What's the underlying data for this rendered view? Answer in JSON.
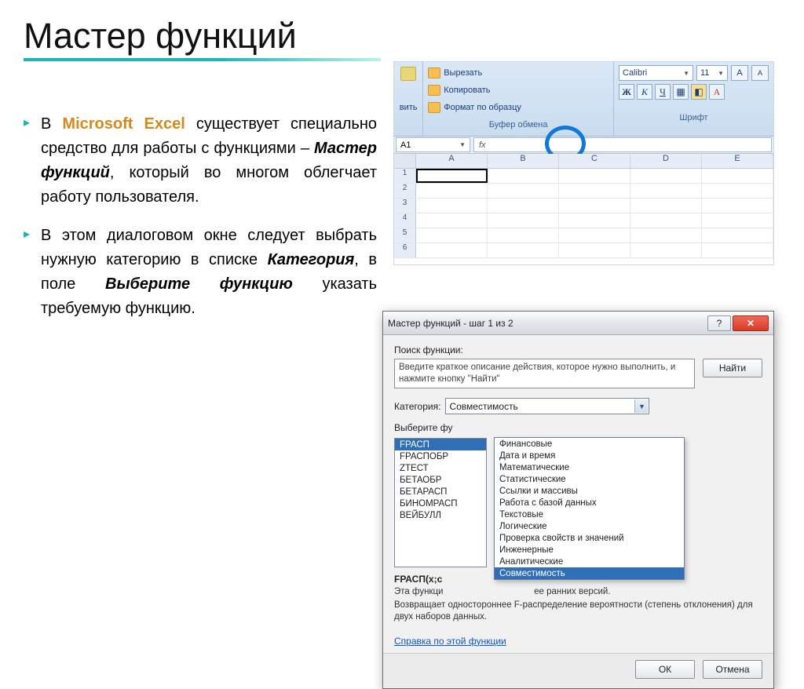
{
  "title": "Мастер функций",
  "paragraphs": {
    "p1_pre": "В ",
    "p1_hl": "Microsoft Excel",
    "p1_mid": " существует специально средство для работы с функциями – ",
    "p1_bi": "Мастер функций",
    "p1_post": ", который во многом облегчает работу пользователя.",
    "p2_pre": "В этом диалоговом окне следует выбрать нужную категорию в списке ",
    "p2_b1": "Категория",
    "p2_mid": ", в поле ",
    "p2_b2": "Выберите функцию",
    "p2_post": " указать требуемую функцию."
  },
  "ribbon": {
    "left_label": "вить",
    "cut": "Вырезать",
    "copy": "Копировать",
    "format_painter": "Формат по образцу",
    "clipboard_group": "Буфер обмена",
    "font_name": "Calibri",
    "font_size": "11",
    "bold": "Ж",
    "italic": "К",
    "underline": "Ч",
    "font_group": "Шрифт"
  },
  "sheet": {
    "namebox": "A1",
    "fx": "fx",
    "cols": [
      "A",
      "B",
      "C",
      "D",
      "E"
    ],
    "rows": [
      "1",
      "2",
      "3",
      "4",
      "5",
      "6"
    ]
  },
  "dialog": {
    "title": "Мастер функций - шаг 1 из 2",
    "search_label": "Поиск функции:",
    "search_text": "Введите краткое описание действия, которое нужно выполнить, и нажмите кнопку \"Найти\"",
    "find_btn": "Найти",
    "category_label": "Категория:",
    "category_value": "Совместимость",
    "select_label": "Выберите фу",
    "functions": [
      "FРАСП",
      "FРАСПОБР",
      "ZТЕСТ",
      "БЕТАОБР",
      "БЕТАРАСП",
      "БИНОМРАСП",
      "ВЕЙБУЛЛ"
    ],
    "categories": [
      "Финансовые",
      "Дата и время",
      "Математические",
      "Статистические",
      "Ссылки и массивы",
      "Работа с базой данных",
      "Текстовые",
      "Логические",
      "Проверка свойств и значений",
      "Инженерные",
      "Аналитические",
      "Совместимость"
    ],
    "signature": "FРАСП(x;с",
    "desc1": "Эта функци",
    "desc1_tail": "ее ранних версий.",
    "desc2": "Возвращает одностороннее F-распределение вероятности (степень отклонения) для двух наборов данных.",
    "help_link": "Справка по этой функции",
    "ok": "ОК",
    "cancel": "Отмена"
  }
}
